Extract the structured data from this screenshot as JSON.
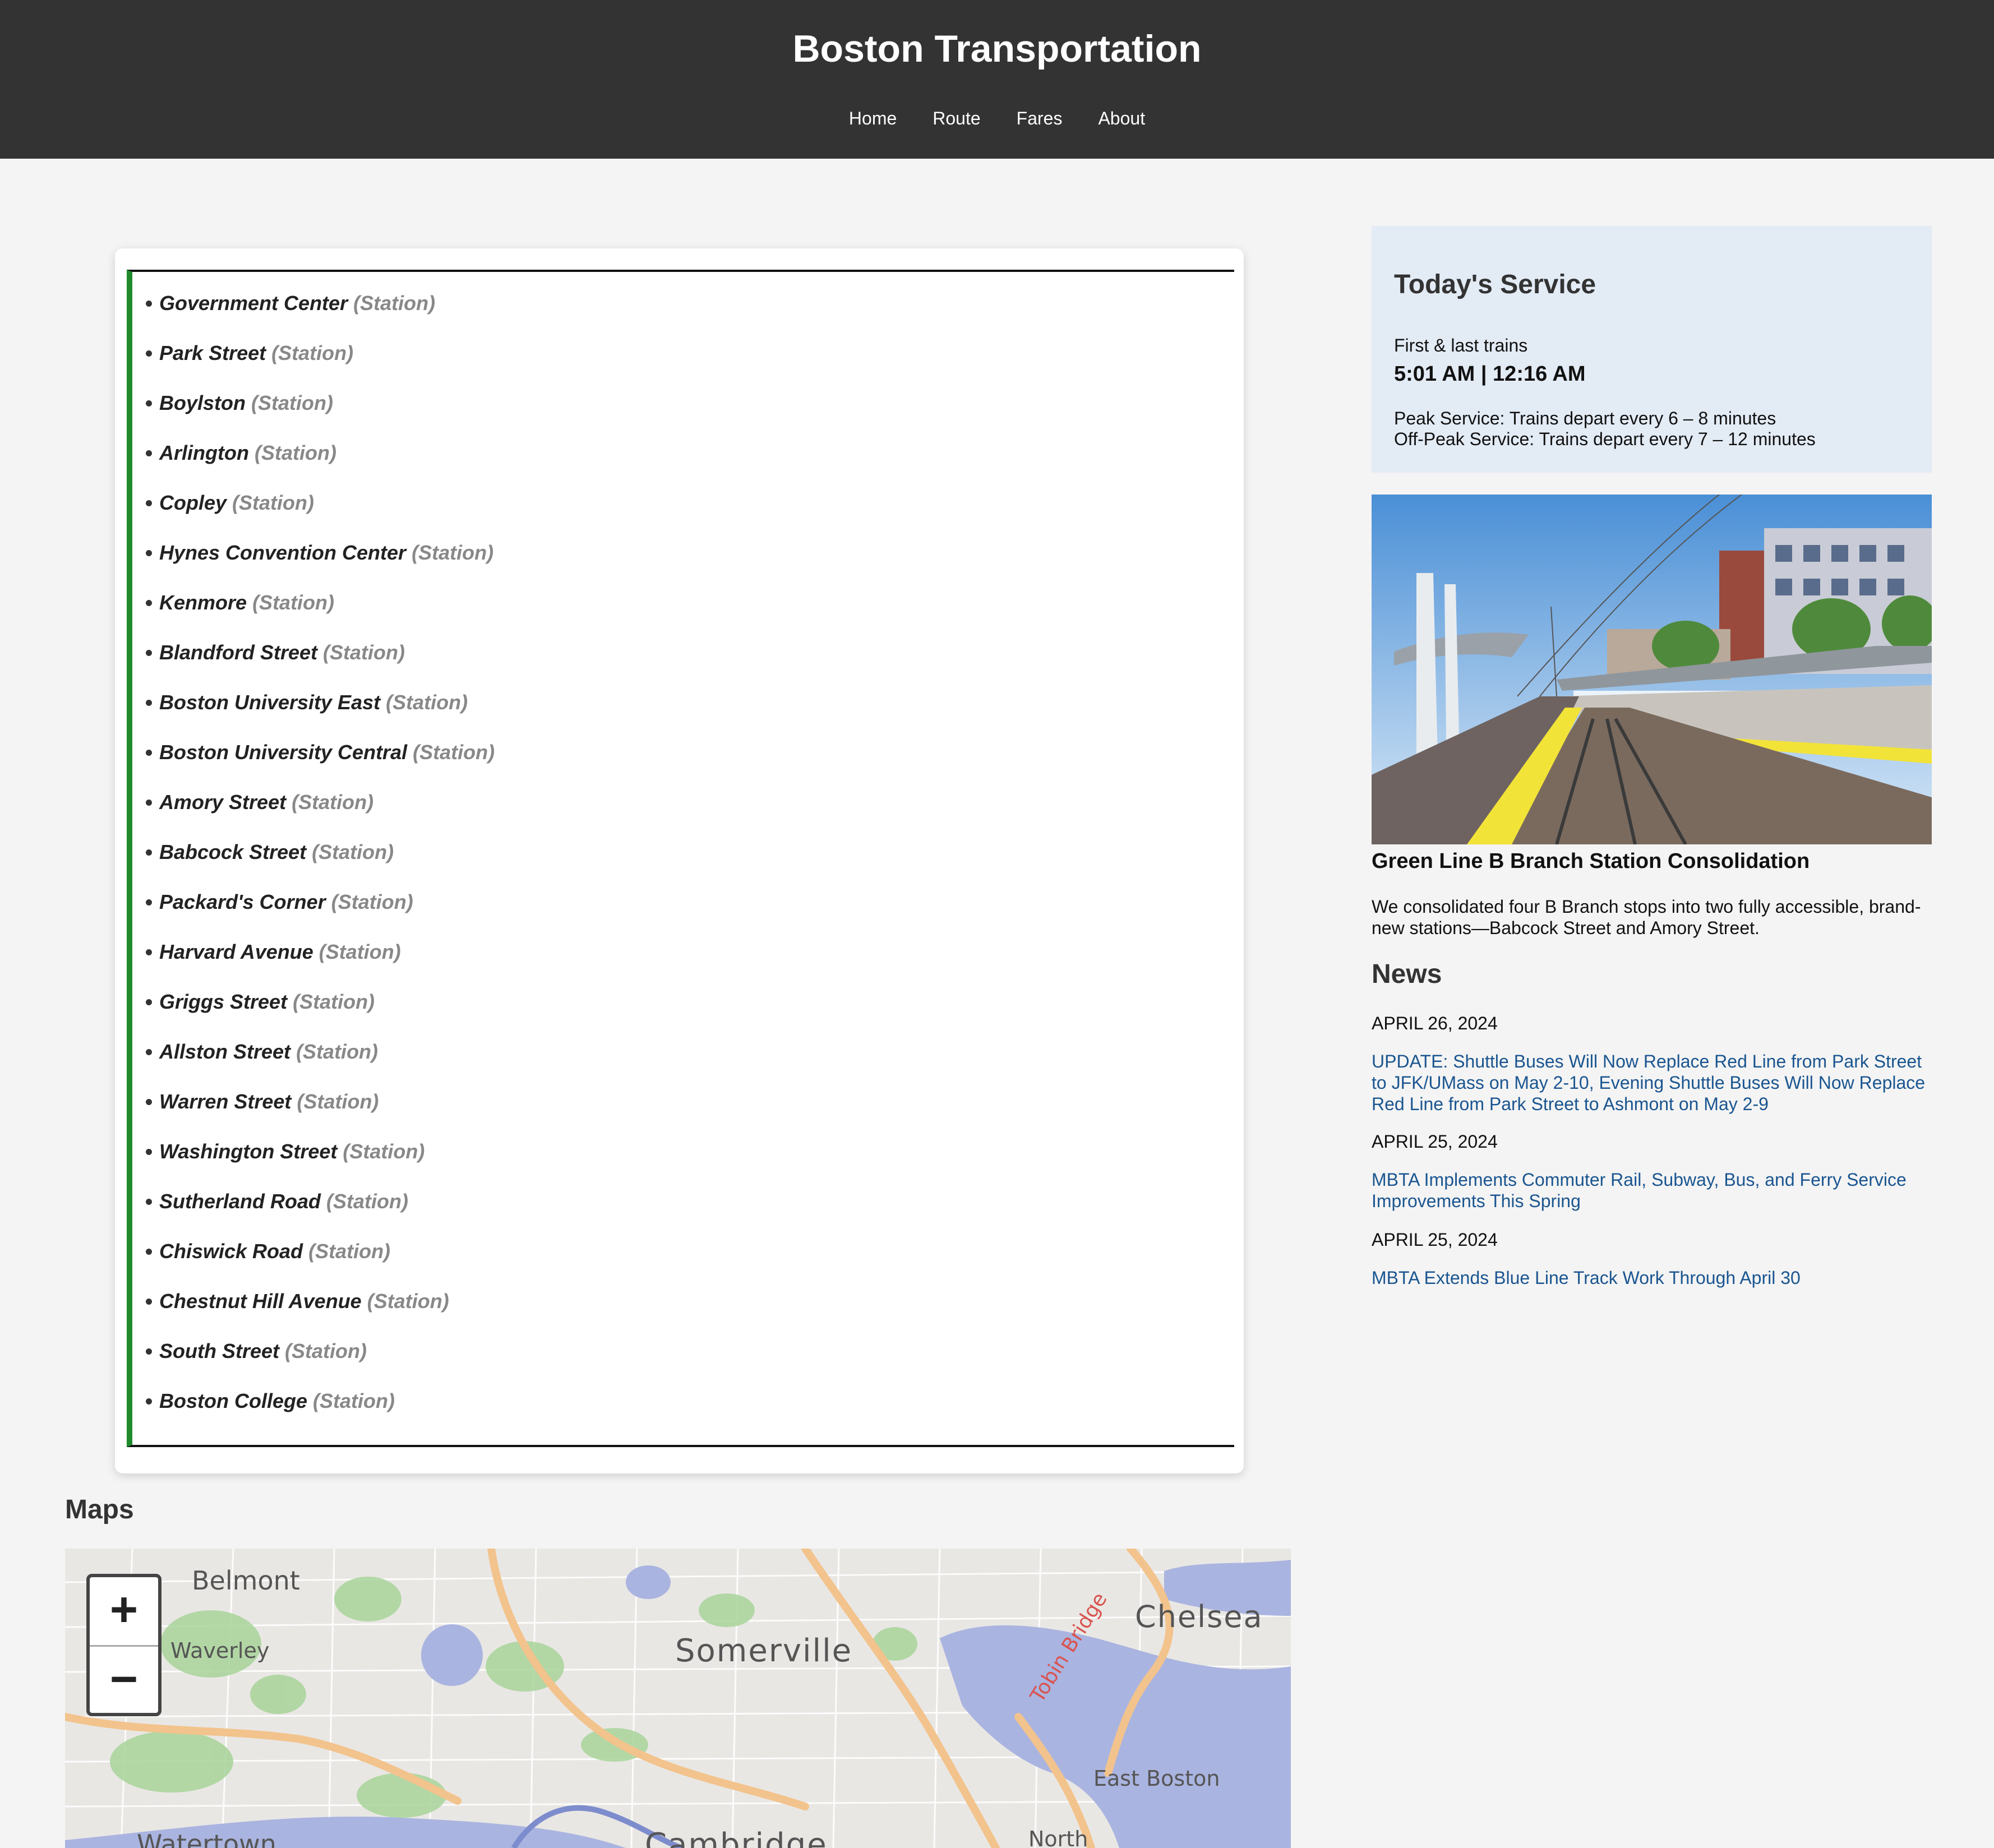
{
  "header": {
    "title": "Boston Transportation",
    "nav": [
      "Home",
      "Route",
      "Fares",
      "About"
    ]
  },
  "stations": {
    "type_label": "(Station)",
    "items": [
      "Government Center",
      "Park Street",
      "Boylston",
      "Arlington",
      "Copley",
      "Hynes Convention Center",
      "Kenmore",
      "Blandford Street",
      "Boston University East",
      "Boston University Central",
      "Amory Street",
      "Babcock Street",
      "Packard's Corner",
      "Harvard Avenue",
      "Griggs Street",
      "Allston Street",
      "Warren Street",
      "Washington Street",
      "Sutherland Road",
      "Chiswick Road",
      "Chestnut Hill Avenue",
      "South Street",
      "Boston College"
    ],
    "line_color": "#1e8a2c"
  },
  "maps": {
    "heading": "Maps",
    "zoom_in": "+",
    "zoom_out": "−",
    "labels": {
      "belmont": "Belmont",
      "waverley": "Waverley",
      "somerville": "Somerville",
      "chelsea": "Chelsea",
      "tobin": "Tobin Bridge",
      "east_boston": "East Boston",
      "watertown": "Watertown",
      "cambridge": "Cambridge",
      "north": "North"
    }
  },
  "service": {
    "title": "Today's Service",
    "first_last_label": "First & last trains",
    "times": "5:01 AM | 12:16 AM",
    "peak": "Peak Service: Trains depart every 6 – 8 minutes",
    "offpeak": "Off-Peak Service: Trains depart every 7 – 12 minutes"
  },
  "feature": {
    "image_icon": "station-platform-image",
    "title": "Green Line B Branch Station Consolidation",
    "description": "We consolidated four B Branch stops into two fully accessible, brand-new stations—Babcock Street and Amory Street."
  },
  "news": {
    "heading": "News",
    "items": [
      {
        "date": "APRIL 26, 2024",
        "title": "UPDATE: Shuttle Buses Will Now Replace Red Line from Park Street to JFK/UMass on May 2-10, Evening Shuttle Buses Will Now Replace Red Line from Park Street to Ashmont on May 2-9"
      },
      {
        "date": "APRIL 25, 2024",
        "title": "MBTA Implements Commuter Rail, Subway, Bus, and Ferry Service Improvements This Spring"
      },
      {
        "date": "APRIL 25, 2024",
        "title": "MBTA Extends Blue Line Track Work Through April 30"
      }
    ],
    "link_color": "#1a5590"
  }
}
